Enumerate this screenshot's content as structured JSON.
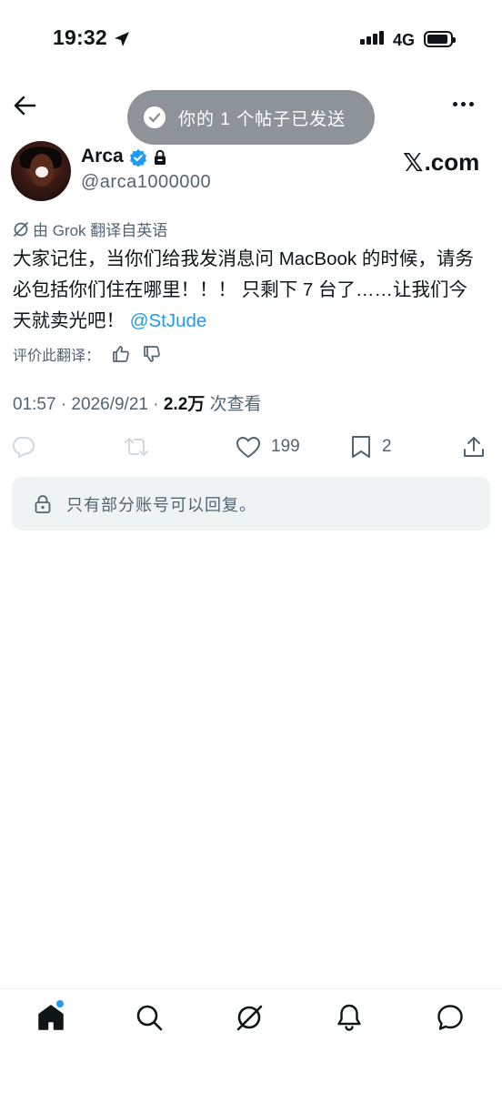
{
  "status_bar": {
    "time": "19:32",
    "network": "4G",
    "icons": [
      "location-arrow-icon",
      "signal-icon",
      "battery-icon"
    ]
  },
  "nav": {
    "back_icon": "arrow-left-icon",
    "more_icon": "more-horizontal-icon"
  },
  "toast": {
    "text": "你的 1 个帖子已发送",
    "icon": "check-circle-icon"
  },
  "author": {
    "name": "Arca",
    "handle": "@arca1000000",
    "verified": true,
    "protected": true,
    "affiliate": "X.com"
  },
  "translation": {
    "label": "由 Grok 翻译自英语",
    "rate_label": "评价此翻译："
  },
  "tweet": {
    "text": "大家记住，当你们给我发消息问 MacBook 的时候，请务必包括你们住在哪里！！！ 只剩下 7 台了……让我们今天就卖光吧！",
    "mention": "@StJude"
  },
  "meta": {
    "time_date": "01:57 · 2026/9/21 · ",
    "views_count": "2.2万",
    "views_label": " 次查看"
  },
  "actions": {
    "likes": "199",
    "bookmarks": "2"
  },
  "reply_restriction": {
    "text": "只有部分账号可以回复。"
  },
  "colors": {
    "accent": "#1d9bf0",
    "text": "#0f1419",
    "secondary": "#536471",
    "disabled": "#cfd9de",
    "toast_bg": "#8e9399",
    "reply_bg": "#eff3f4"
  },
  "tabbar": {
    "items": [
      "home-icon",
      "search-icon",
      "grok-icon",
      "notifications-icon",
      "messages-icon"
    ]
  }
}
